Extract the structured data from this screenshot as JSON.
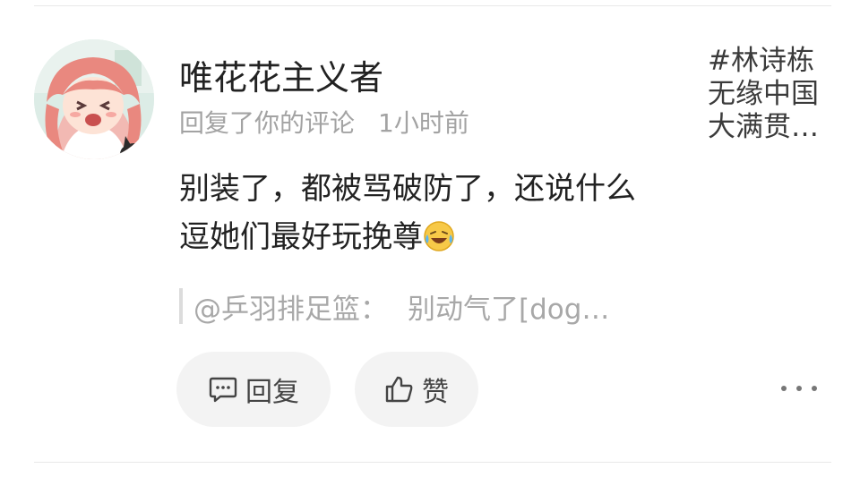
{
  "comment": {
    "username": "唯花花主义者",
    "action": "回复了你的评论",
    "time": "1小时前",
    "body": "别装了，都被骂破防了，还说什么逗她们最好玩挽尊",
    "emoji_icon": "laughing-crying-emoji",
    "quote": {
      "author": "@乒羽排足篮：",
      "text": "别动气了[dog…"
    }
  },
  "source_post": {
    "lines": [
      "#林诗栋",
      "无缘中国",
      "大满贯…"
    ]
  },
  "actions": {
    "reply_label": "回复",
    "like_label": "赞",
    "more_icon": "more-dots-icon"
  },
  "colors": {
    "text_primary": "#222222",
    "text_secondary": "#a3a3a3",
    "button_bg": "#f3f3f3"
  }
}
